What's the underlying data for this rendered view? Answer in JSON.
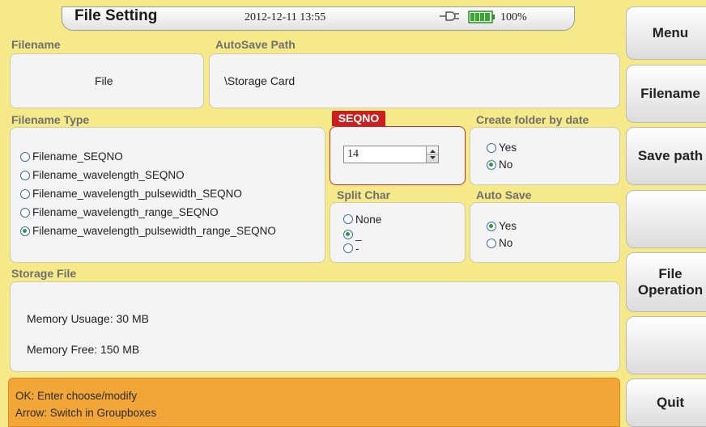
{
  "header": {
    "title": "File Setting",
    "datetime": "2012-12-11 13:55",
    "battery": "100%",
    "icons": [
      "plug-icon",
      "battery-icon"
    ]
  },
  "filename": {
    "label": "Filename",
    "value": "File"
  },
  "autosave_path": {
    "label": "AutoSave Path",
    "value": "\\Storage Card"
  },
  "filename_type": {
    "label": "Filename Type",
    "options": [
      {
        "label": "Filename_SEQNO",
        "checked": false
      },
      {
        "label": "Filename_wavelength_SEQNO",
        "checked": false
      },
      {
        "label": "Filename_wavelength_pulsewidth_SEQNO",
        "checked": false
      },
      {
        "label": "Filename_wavelength_range_SEQNO",
        "checked": false
      },
      {
        "label": "Filename_wavelength_pulsewidth_range_SEQNO",
        "checked": true
      }
    ]
  },
  "seqno": {
    "label": "SEQNO",
    "value": "14"
  },
  "create_folder": {
    "label": "Create folder by date",
    "options": [
      {
        "label": "Yes",
        "checked": false
      },
      {
        "label": "No",
        "checked": true
      }
    ]
  },
  "split_char": {
    "label": "Split Char",
    "options": [
      {
        "label": "None",
        "checked": false
      },
      {
        "label": "_",
        "checked": true
      },
      {
        "label": "-",
        "checked": false
      }
    ]
  },
  "auto_save": {
    "label": "Auto Save",
    "options": [
      {
        "label": "Yes",
        "checked": true
      },
      {
        "label": "No",
        "checked": false
      }
    ]
  },
  "storage": {
    "label": "Storage File",
    "memory_usage": "Memory Usuage: 30 MB",
    "memory_free": "Memory Free: 150 MB"
  },
  "hint": {
    "line1": "OK: Enter choose/modify",
    "line2": "Arrow: Switch in Groupboxes"
  },
  "menu": {
    "menu": "Menu",
    "filename": "Filename",
    "save_path": "Save path",
    "empty1": "",
    "file_operation_1": "File",
    "file_operation_2": "Operation",
    "empty2": "",
    "quit": "Quit"
  },
  "colors": {
    "background": "#f6e98a",
    "hint_bar": "#f2a637",
    "seqno_accent": "#cc1e1e",
    "radio_selected": "#2f9a3a"
  }
}
